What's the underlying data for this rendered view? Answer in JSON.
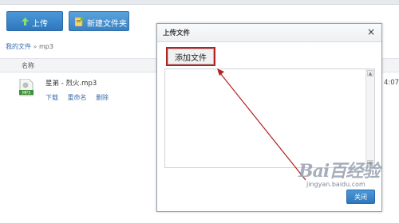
{
  "toolbar": {
    "upload_label": "上传",
    "newfolder_label": "新建文件夹"
  },
  "breadcrumb": {
    "root": "我的文件",
    "sep": "»",
    "current": "mp3"
  },
  "table": {
    "col_name": "名称"
  },
  "file": {
    "name": "星弟 - 烈火.mp3",
    "icon_text": "MP3",
    "actions": [
      "下载",
      "重命名",
      "删除"
    ],
    "time": "4:07"
  },
  "dialog": {
    "title": "上传文件",
    "close": "×",
    "add_file_label": "添加文件",
    "ok_label": "关闭"
  },
  "watermark": {
    "brand": "Bai百经验",
    "site": "jingyan.baidu.com"
  },
  "colors": {
    "accent_blue": "#2f77bd",
    "annotation_red": "#b22222",
    "link_blue": "#3a6eb0"
  }
}
